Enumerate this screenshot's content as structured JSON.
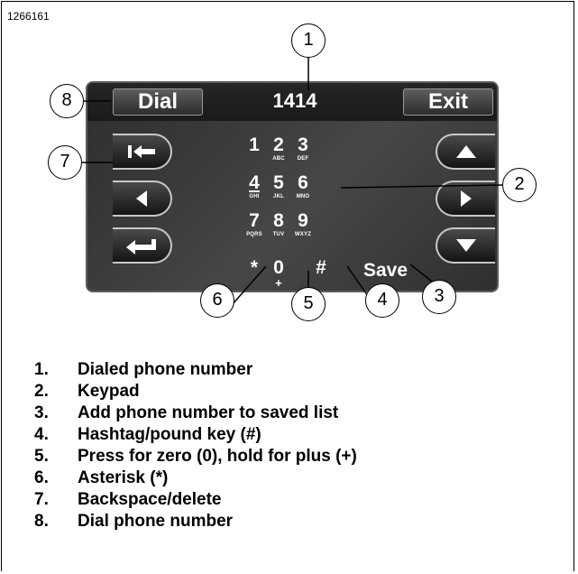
{
  "figure_id": "1266161",
  "screen": {
    "dial_label": "Dial",
    "exit_label": "Exit",
    "number": "1414",
    "save_label": "Save",
    "keys": [
      {
        "digit": "1",
        "letters": ""
      },
      {
        "digit": "2",
        "letters": "ABC"
      },
      {
        "digit": "3",
        "letters": "DEF"
      },
      {
        "digit": "4",
        "letters": "GHI"
      },
      {
        "digit": "5",
        "letters": "JKL"
      },
      {
        "digit": "6",
        "letters": "MNO"
      },
      {
        "digit": "7",
        "letters": "PQRS"
      },
      {
        "digit": "8",
        "letters": "TUV"
      },
      {
        "digit": "9",
        "letters": "WXYZ"
      },
      {
        "digit": "*",
        "letters": ""
      },
      {
        "digit": "0",
        "letters": "+"
      },
      {
        "digit": "#",
        "letters": ""
      }
    ],
    "left_buttons": [
      "backspace-icon",
      "arrow-left-icon",
      "enter-return-icon"
    ],
    "right_buttons": [
      "arrow-up-icon",
      "arrow-right-icon",
      "arrow-down-icon"
    ]
  },
  "callouts": [
    "1",
    "2",
    "3",
    "4",
    "5",
    "6",
    "7",
    "8"
  ],
  "legend": [
    {
      "num": "1.",
      "text": "Dialed phone number"
    },
    {
      "num": "2.",
      "text": "Keypad"
    },
    {
      "num": "3.",
      "text": "Add phone number to saved list"
    },
    {
      "num": "4.",
      "text": "Hashtag/pound key (#)"
    },
    {
      "num": "5.",
      "text": "Press for zero (0), hold for plus (+)"
    },
    {
      "num": "6.",
      "text": "Asterisk (*)"
    },
    {
      "num": "7.",
      "text": "Backspace/delete"
    },
    {
      "num": "8.",
      "text": "Dial phone number"
    }
  ]
}
